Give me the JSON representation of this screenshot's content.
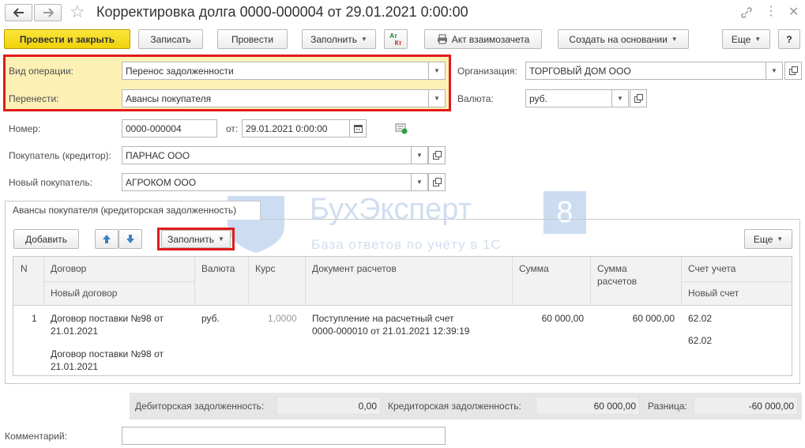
{
  "window": {
    "title": "Корректировка долга 0000-000004 от 29.01.2021 0:00:00"
  },
  "toolbar": {
    "post_close": "Провести и закрыть",
    "save": "Записать",
    "post": "Провести",
    "fill": "Заполнить",
    "dtkt_top": "Ат",
    "dtkt_bottom": "Кт",
    "offset_act": "Акт взаимозачета",
    "create_based": "Создать на основании",
    "more": "Еще",
    "help": "?"
  },
  "form": {
    "operation_label": "Вид операции:",
    "operation_value": "Перенос задолженности",
    "transfer_label": "Перенести:",
    "transfer_value": "Авансы покупателя",
    "org_label": "Организация:",
    "org_value": "ТОРГОВЫЙ ДОМ ООО",
    "currency_label": "Валюта:",
    "currency_value": "руб.",
    "number_label": "Номер:",
    "number_value": "0000-000004",
    "date_label": "от:",
    "date_value": "29.01.2021  0:00:00",
    "buyer_label": "Покупатель (кредитор):",
    "buyer_value": "ПАРНАС ООО",
    "new_buyer_label": "Новый покупатель:",
    "new_buyer_value": "АГРОКОМ ООО"
  },
  "tab": {
    "label": "Авансы покупателя (кредиторская задолженность)"
  },
  "table_toolbar": {
    "add": "Добавить",
    "fill": "Заполнить",
    "more": "Еще"
  },
  "watermark": {
    "brand": "БухЭксперт",
    "digit": "8",
    "tagline": "База ответов по учёту в 1С"
  },
  "table": {
    "headers": {
      "n": "N",
      "contract": "Договор",
      "new_contract": "Новый договор",
      "currency": "Валюта",
      "rate": "Курс",
      "doc": "Документ расчетов",
      "sum": "Сумма",
      "sum_calc_1": "Сумма",
      "sum_calc_2": "расчетов",
      "account": "Счет учета",
      "new_account": "Новый счет"
    },
    "rows": [
      {
        "n": "1",
        "contract_1": "Договор поставки №98 от",
        "contract_2": "21.01.2021",
        "new_contract_1": "Договор поставки №98 от",
        "new_contract_2": "21.01.2021",
        "currency": "руб.",
        "rate": "1,0000",
        "doc_1": "Поступление на расчетный счет",
        "doc_2": "0000-000010 от 21.01.2021 12:39:19",
        "sum": "60 000,00",
        "sum_calc": "60 000,00",
        "account": "62.02",
        "new_account": "62.02"
      }
    ]
  },
  "totals": {
    "debit_label": "Дебиторская задолженность:",
    "debit_value": "0,00",
    "credit_label": "Кредиторская задолженность:",
    "credit_value": "60 000,00",
    "diff_label": "Разница:",
    "diff_value": "-60 000,00"
  },
  "comment": {
    "label": "Комментарий:",
    "value": ""
  },
  "colors": {
    "primary_button": "#f0d20a",
    "highlight_box": "#e01b1b",
    "highlight_fill": "#fcf0b5",
    "nav_arrow": "#3b82c4"
  }
}
